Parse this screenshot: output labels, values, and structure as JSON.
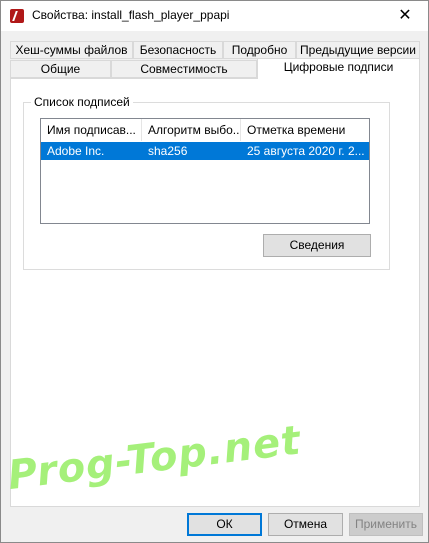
{
  "window": {
    "title": "Свойства: install_flash_player_ppapi",
    "close_glyph": "✕"
  },
  "tabs": {
    "row1": [
      {
        "label": "Хеш-суммы файлов"
      },
      {
        "label": "Безопасность"
      },
      {
        "label": "Подробно"
      },
      {
        "label": "Предыдущие версии"
      }
    ],
    "row2": [
      {
        "label": "Общие"
      },
      {
        "label": "Совместимость"
      },
      {
        "label": "Цифровые подписи",
        "active": true
      }
    ]
  },
  "signatures": {
    "group_label": "Список подписей",
    "columns": [
      "Имя подписав...",
      "Алгоритм выбо...",
      "Отметка времени"
    ],
    "rows": [
      {
        "name": "Adobe Inc.",
        "algorithm": "sha256",
        "timestamp": "25 августа 2020 г. 2...",
        "selected": true
      }
    ],
    "details_button": "Сведения"
  },
  "buttons": {
    "ok": "ОК",
    "cancel": "Отмена",
    "apply": "Применить"
  },
  "watermark": "Prog-Top.net",
  "colors": {
    "selection": "#0078d7",
    "watermark": "#6ee628"
  }
}
